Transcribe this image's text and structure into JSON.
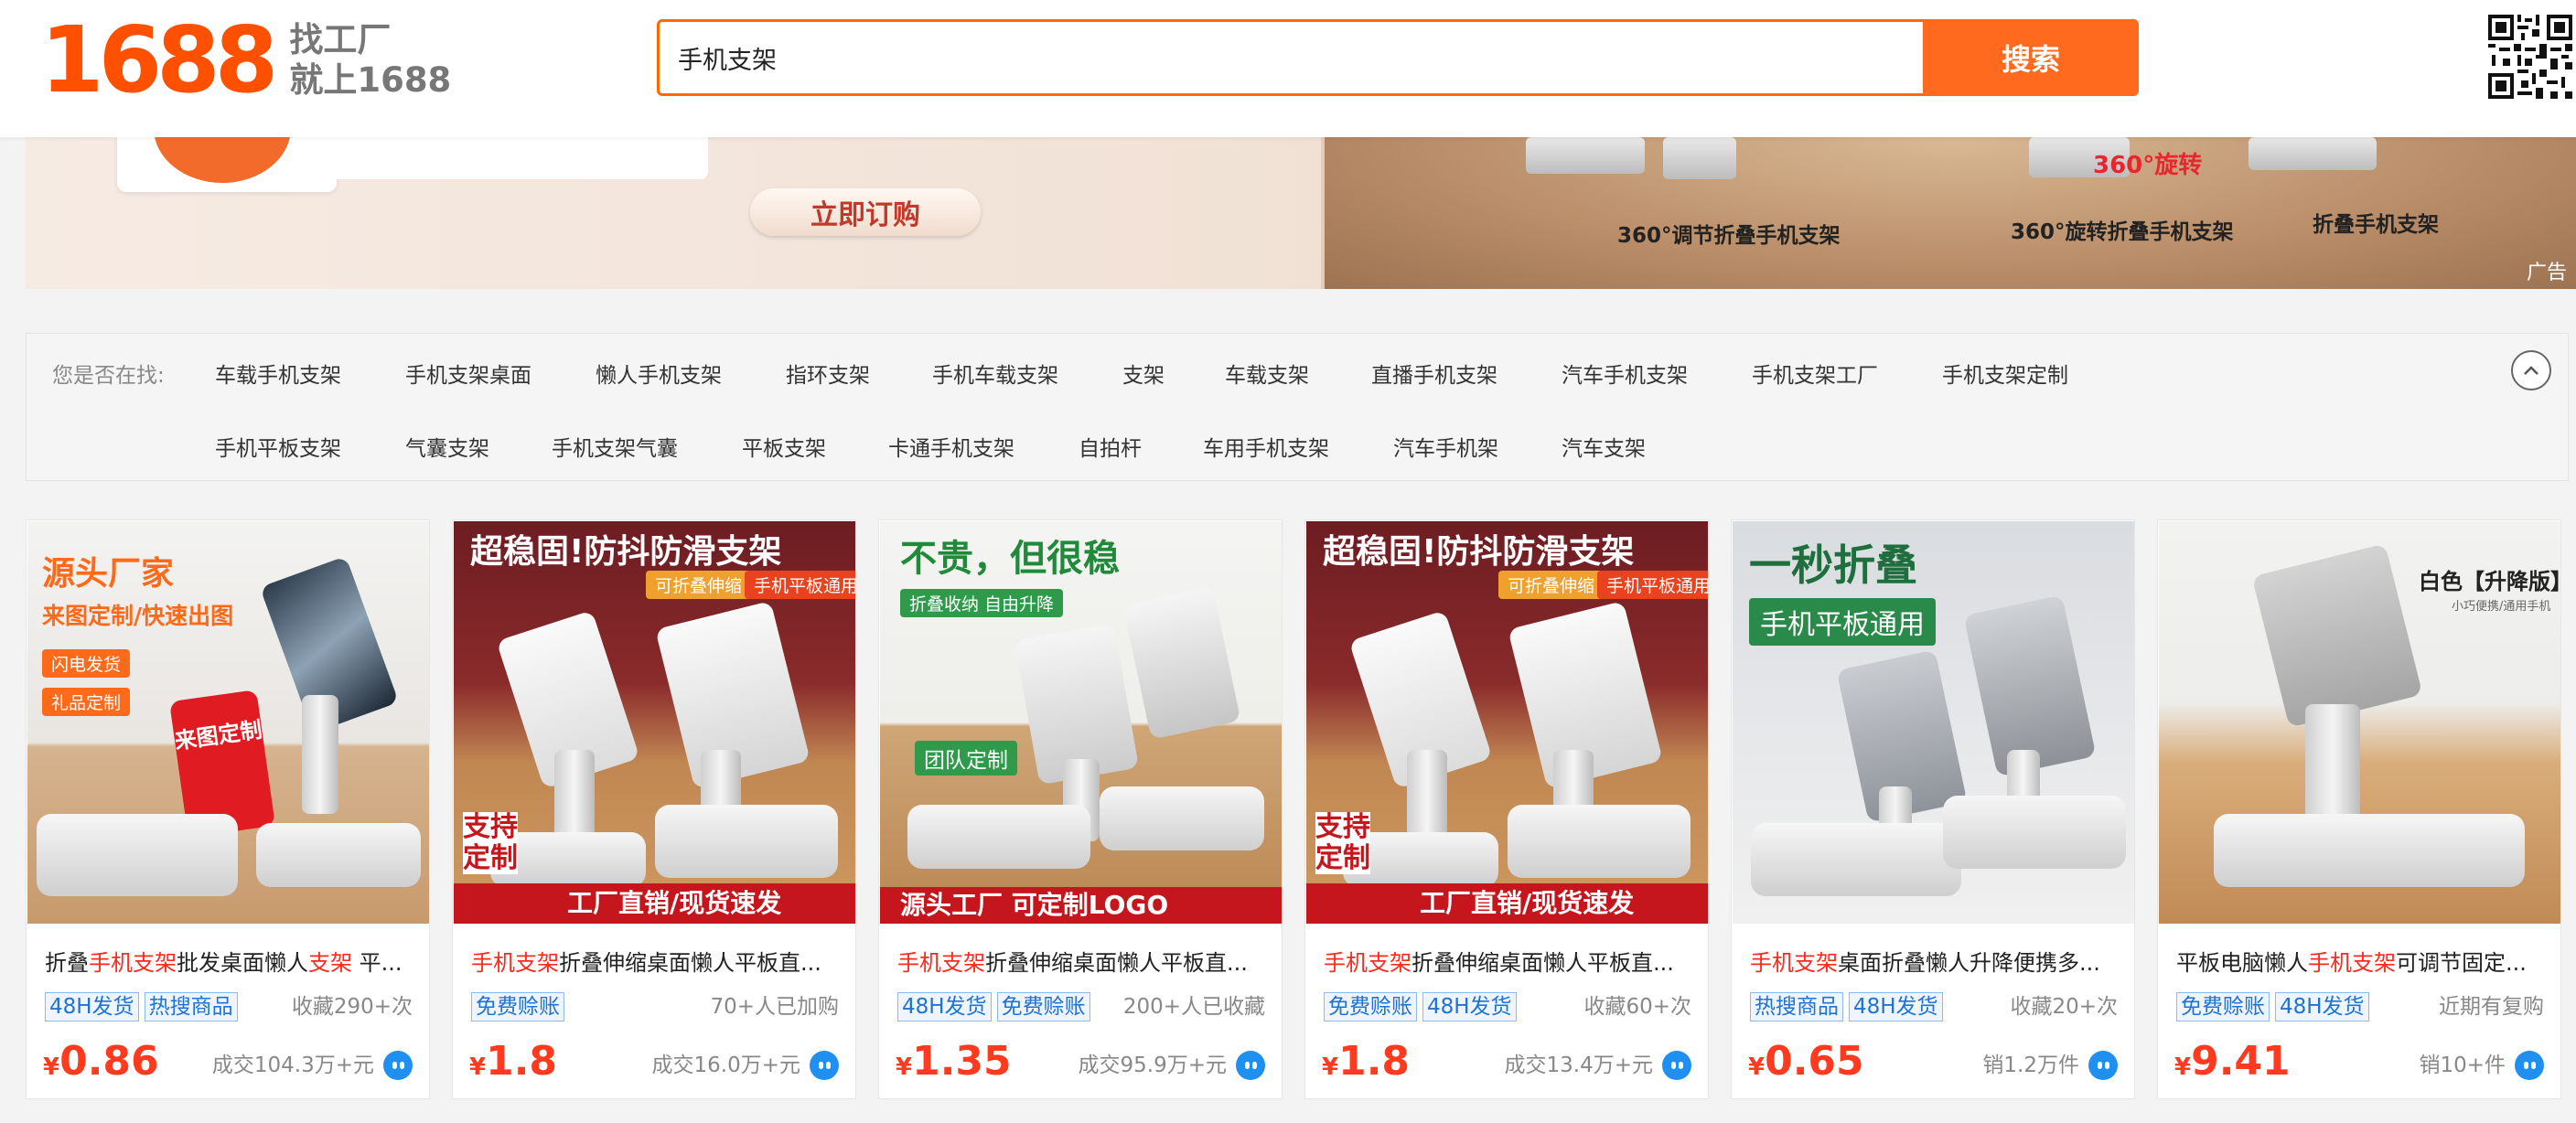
{
  "header": {
    "logo_number": "1688",
    "slogan_line1": "找工厂",
    "slogan_line2": "就上1688",
    "search_value": "手机支架",
    "search_button": "搜索"
  },
  "banner": {
    "order_button": "立即订购",
    "label1": "360°调节折叠手机支架",
    "label2": "360°旋转折叠手机支架",
    "label3": "折叠手机支架",
    "rotate_tag": "360°旋转",
    "ad_tag": "广告"
  },
  "suggest": {
    "label": "您是否在找:",
    "row1": [
      "车载手机支架",
      "手机支架桌面",
      "懒人手机支架",
      "指环支架",
      "手机车载支架",
      "支架",
      "车载支架",
      "直播手机支架",
      "汽车手机支架",
      "手机支架工厂",
      "手机支架定制"
    ],
    "row2": [
      "手机平板支架",
      "气囊支架",
      "手机支架气囊",
      "平板支架",
      "卡通手机支架",
      "自拍杆",
      "车用手机支架",
      "汽车手机架",
      "汽车支架"
    ]
  },
  "products": [
    {
      "img": {
        "line1": "源头厂家",
        "line2": "来图定制/快速出图",
        "pill1": "闪电发货",
        "pill2": "礼品定制",
        "card_text": "来图定制"
      },
      "title_pre": "折叠",
      "title_hl": "手机支架",
      "title_mid": "批发桌面懒人",
      "title_hl2": "支架",
      "title_post": " 平...",
      "tags": [
        "48H发货",
        "热搜商品"
      ],
      "meta": "收藏290+次",
      "price": "0.86",
      "deals": "成交104.3万+元"
    },
    {
      "img": {
        "headline": "超稳固!防抖防滑支架",
        "pill1": "可折叠伸缩",
        "pill2": "手机平板通用",
        "side_text": "支持定制",
        "bar_text": "工厂直销/现货速发"
      },
      "title_pre": "",
      "title_hl": "手机支架",
      "title_mid": "折叠伸缩桌面懒人平板直...",
      "title_hl2": "",
      "title_post": "",
      "tags": [
        "免费赊账"
      ],
      "meta": "70+人已加购",
      "price": "1.8",
      "deals": "成交16.0万+元"
    },
    {
      "img": {
        "headline": "不贵，但很稳",
        "pill1": "折叠收纳 自由升降",
        "pill2": "团队定制",
        "bar_text": "源头工厂  可定制LOGO"
      },
      "title_pre": "",
      "title_hl": "手机支架",
      "title_mid": "折叠伸缩桌面懒人平板直...",
      "title_hl2": "",
      "title_post": "",
      "tags": [
        "48H发货",
        "免费赊账"
      ],
      "meta": "200+人已收藏",
      "price": "1.35",
      "deals": "成交95.9万+元"
    },
    {
      "img": {
        "headline": "超稳固!防抖防滑支架",
        "pill1": "可折叠伸缩",
        "pill2": "手机平板通用",
        "side_text": "支持定制",
        "bar_text": "工厂直销/现货速发"
      },
      "title_pre": "",
      "title_hl": "手机支架",
      "title_mid": "折叠伸缩桌面懒人平板直...",
      "title_hl2": "",
      "title_post": "",
      "tags": [
        "免费赊账",
        "48H发货"
      ],
      "meta": "收藏60+次",
      "price": "1.8",
      "deals": "成交13.4万+元"
    },
    {
      "img": {
        "headline": "一秒折叠",
        "pill1": "手机平板通用"
      },
      "title_pre": "",
      "title_hl": "手机支架",
      "title_mid": "桌面折叠懒人升降便携多...",
      "title_hl2": "",
      "title_post": "",
      "tags": [
        "热搜商品",
        "48H发货"
      ],
      "meta": "收藏20+次",
      "price": "0.65",
      "deals": "销1.2万件"
    },
    {
      "img": {
        "headline": "白色【升降版】",
        "sub": "小巧便携/通用手机"
      },
      "title_pre": "平板电脑懒人",
      "title_hl": "手机支架",
      "title_mid": "可调节固定...",
      "title_hl2": "",
      "title_post": "",
      "tags": [
        "免费赊账",
        "48H发货"
      ],
      "meta": "近期有复购",
      "price": "9.41",
      "deals": "销10+件"
    }
  ],
  "currency": "¥",
  "colors": {
    "brand": "#ff5000",
    "price": "#ff3a1f",
    "tag": "#1e73d4"
  }
}
